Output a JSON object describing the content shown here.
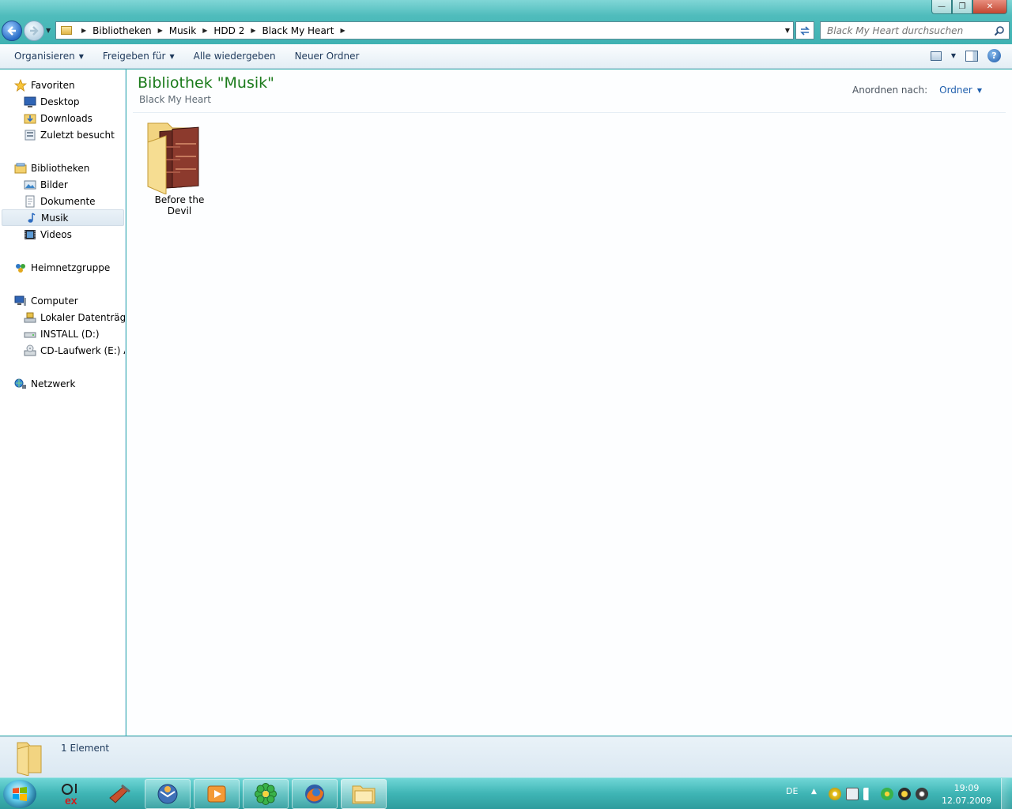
{
  "window": {
    "caption_buttons": {
      "minimize": "—",
      "maximize": "❐",
      "close": "✕"
    }
  },
  "nav": {
    "back_icon": "back-arrow-icon",
    "forward_icon": "forward-arrow-icon",
    "breadcrumb": [
      "Bibliotheken",
      "Musik",
      "HDD 2",
      "Black My Heart"
    ],
    "search_placeholder": "Black My Heart durchsuchen"
  },
  "toolbar": {
    "organize_label": "Organisieren",
    "share_label": "Freigeben für",
    "play_all_label": "Alle wiedergeben",
    "new_folder_label": "Neuer Ordner"
  },
  "sidebar": {
    "favorites": {
      "label": "Favoriten",
      "items": [
        {
          "label": "Desktop",
          "icon": "desktop-icon"
        },
        {
          "label": "Downloads",
          "icon": "downloads-folder-icon"
        },
        {
          "label": "Zuletzt besucht",
          "icon": "recent-places-icon"
        }
      ]
    },
    "libraries": {
      "label": "Bibliotheken",
      "items": [
        {
          "label": "Bilder",
          "icon": "pictures-icon"
        },
        {
          "label": "Dokumente",
          "icon": "documents-icon"
        },
        {
          "label": "Musik",
          "icon": "music-icon",
          "selected": true
        },
        {
          "label": "Videos",
          "icon": "videos-icon"
        }
      ]
    },
    "homegroup": {
      "label": "Heimnetzgruppe"
    },
    "computer": {
      "label": "Computer",
      "items": [
        {
          "label": "Lokaler Datenträger",
          "icon": "local-disk-icon"
        },
        {
          "label": "INSTALL (D:)",
          "icon": "drive-icon"
        },
        {
          "label": "CD-Laufwerk (E:) Au",
          "icon": "cd-drive-icon"
        }
      ]
    },
    "network": {
      "label": "Netzwerk"
    }
  },
  "main": {
    "library_title": "Bibliothek \"Musik\"",
    "library_subtitle": "Black My Heart",
    "arrange_label": "Anordnen nach:",
    "arrange_value": "Ordner",
    "items": [
      {
        "label": "Before the Devil",
        "icon": "album-folder-icon"
      }
    ]
  },
  "details": {
    "count_label": "1 Element"
  },
  "taskbar": {
    "language": "DE",
    "time": "19:09",
    "date": "12.07.2009"
  },
  "colors": {
    "accent_title": "#1a7a1a",
    "link_blue": "#1f5fad",
    "taskbar_teal": "#3fb5b5"
  }
}
